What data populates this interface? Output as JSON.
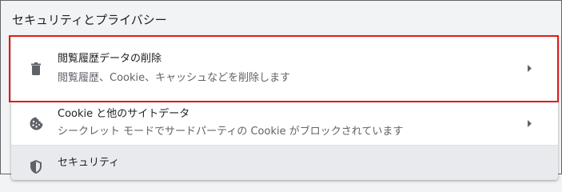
{
  "section_title": "セキュリティとプライバシー",
  "items": [
    {
      "icon": "trash-icon",
      "title": "閲覧履歴データの削除",
      "subtitle": "閲覧履歴、Cookie、キャッシュなどを削除します"
    },
    {
      "icon": "cookie-icon",
      "title": "Cookie と他のサイトデータ",
      "subtitle": "シークレット モードでサードパーティの Cookie がブロックされています"
    },
    {
      "icon": "shield-icon",
      "title": "セキュリティ",
      "subtitle": ""
    }
  ],
  "colors": {
    "highlight": "#e21a1a",
    "icon": "#5f6368"
  }
}
